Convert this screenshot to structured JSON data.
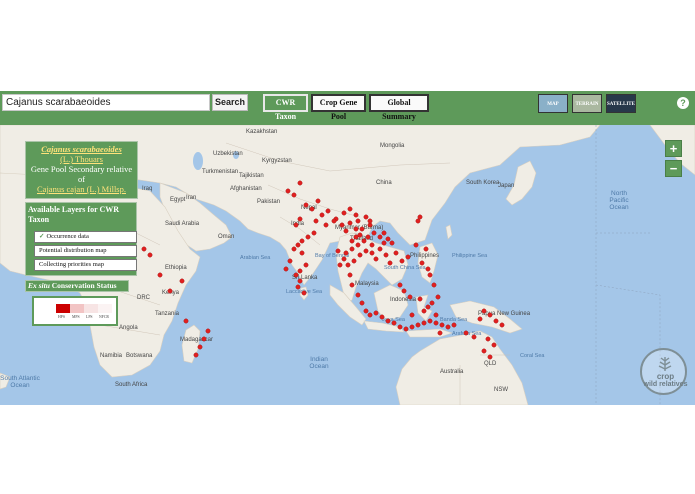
{
  "search": {
    "value": "Cajanus scarabaeoides",
    "button_label": "Search"
  },
  "tabs": {
    "cwr": "CWR Taxon",
    "crop": "Crop Gene Pool",
    "global": "Global Summary"
  },
  "map_types": {
    "map": "MAP",
    "terrain": "TERRAIN",
    "satellite": "SATELLITE"
  },
  "help_label": "?",
  "info": {
    "taxon": "Cajanus scarabaeoides",
    "author": "(L.) Thouars",
    "relation": "Gene Pool Secondary relative",
    "of": "of",
    "crop": "Cajanus cajan (L.) Millsp."
  },
  "layers": {
    "title": "Available Layers for CWR Taxon",
    "items": [
      {
        "label": "Occurrence data",
        "checked": true
      },
      {
        "label": "Potential distribution map",
        "checked": false
      },
      {
        "label": "Collecting priorities map",
        "checked": false
      }
    ],
    "check_glyph": "✓"
  },
  "conservation": {
    "title_italic": "Ex situ",
    "title_rest": "Conservation Status",
    "legend": [
      {
        "label": "HPS",
        "color": "#cc0000"
      },
      {
        "label": "MPS",
        "color": "#f2c4c4"
      },
      {
        "label": "LPS",
        "color": "#f7e4e4"
      },
      {
        "label": "NFCR",
        "color": "#fbf3f3"
      }
    ]
  },
  "zoom": {
    "in": "+",
    "out": "−"
  },
  "watermark": {
    "line1": "crop",
    "line2": "wild relatives"
  },
  "colors": {
    "accent": "#5e9a5a",
    "link": "#ffe27a",
    "ocean": "#a4c6e8",
    "land": "#f0ede5",
    "point": "#e02020"
  },
  "map_labels": [
    "Kazakhstan",
    "Mongolia",
    "Uzbekistan",
    "Kyrgyzstan",
    "Turkmenistan",
    "Tajikistan",
    "Afghanistan",
    "Iraq",
    "Iran",
    "China",
    "South Korea",
    "Japan",
    "Pakistan",
    "Nepal",
    "Saudi Arabia",
    "Oman",
    "India",
    "Myanmar (Burma)",
    "Thailand",
    "Philippines",
    "Malaysia",
    "Indonesia",
    "Papua New Guinea",
    "Sri Lanka",
    "Ethiopia",
    "Kenya",
    "Tanzania",
    "Angola",
    "Namibia",
    "Botswana",
    "South Africa",
    "Madagascar",
    "DRC",
    "Egypt",
    "Australia",
    "QLD",
    "NSW",
    "North Pacific Ocean",
    "South Atlantic Ocean",
    "Indian Ocean",
    "Arabian Sea",
    "Bay of Bengal",
    "Laccadive Sea",
    "Philippine Sea",
    "South China Sea",
    "Java Sea",
    "Banda Sea",
    "Coral Sea",
    "Arafura Sea"
  ]
}
